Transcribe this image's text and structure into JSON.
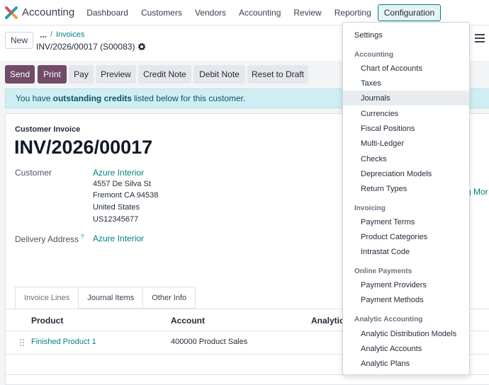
{
  "app": {
    "name": "Accounting",
    "nav": [
      "Dashboard",
      "Customers",
      "Vendors",
      "Accounting",
      "Review",
      "Reporting",
      "Configuration"
    ],
    "active_nav": "Configuration"
  },
  "control_panel": {
    "new_label": "New",
    "breadcrumb_dots": "...",
    "breadcrumb_sep": "/",
    "breadcrumb_parent": "Invoices",
    "record_name": "INV/2026/00017 (S00083)"
  },
  "actions": {
    "send": "Send",
    "print": "Print",
    "pay": "Pay",
    "preview": "Preview",
    "credit_note": "Credit Note",
    "debit_note": "Debit Note",
    "reset_to_draft": "Reset to Draft"
  },
  "alert": {
    "prefix": "You have",
    "bold": "outstanding credits",
    "suffix": "listed below for this customer."
  },
  "form": {
    "doc_type": "Customer Invoice",
    "doc_number": "INV/2026/00017",
    "customer_label": "Customer",
    "customer_name": "Azure Interior",
    "customer_address": [
      "4557 De Silva St",
      "Fremont CA 94538",
      "United States",
      "US12345677"
    ],
    "delivery_label": "Delivery Address",
    "delivery_help": "?",
    "delivery_name": "Azure Interior",
    "cut_link": "g Mor"
  },
  "tabs": [
    "Invoice Lines",
    "Journal Items",
    "Other Info"
  ],
  "table": {
    "columns": [
      "Product",
      "Account",
      "Analytic"
    ],
    "rows": [
      {
        "product": "Finished Product 1",
        "account": "400000 Product Sales"
      }
    ]
  },
  "dropdown": {
    "top_item": "Settings",
    "sections": [
      {
        "header": "Accounting",
        "items": [
          "Chart of Accounts",
          "Taxes",
          "Journals",
          "Currencies",
          "Fiscal Positions",
          "Multi-Ledger",
          "Checks",
          "Depreciation Models",
          "Return Types"
        ]
      },
      {
        "header": "Invoicing",
        "items": [
          "Payment Terms",
          "Product Categories",
          "Intrastat Code"
        ]
      },
      {
        "header": "Online Payments",
        "items": [
          "Payment Providers",
          "Payment Methods"
        ]
      },
      {
        "header": "Analytic Accounting",
        "items": [
          "Analytic Distribution Models",
          "Analytic Accounts",
          "Analytic Plans"
        ]
      }
    ],
    "hovered_item": "Journals"
  },
  "colors": {
    "primary": "#714b67",
    "link": "#017e84",
    "alert_bg": "#cfeef3"
  }
}
